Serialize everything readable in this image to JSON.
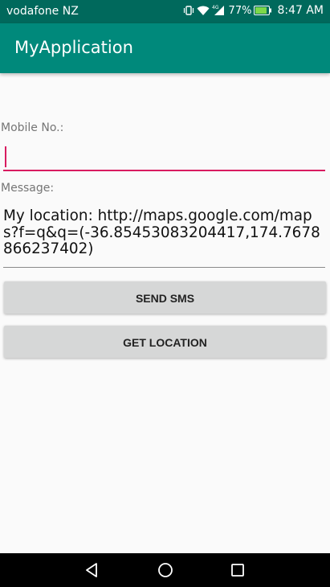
{
  "status_bar": {
    "carrier": "vodafone NZ",
    "network": "4G",
    "battery": "77%",
    "time": "8:47 AM",
    "icons": [
      "vibrate-icon",
      "wifi-icon",
      "cellular-signal-icon",
      "battery-icon"
    ]
  },
  "app_bar": {
    "title": "MyApplication"
  },
  "form": {
    "mobile_label": "Mobile No.:",
    "mobile_value": "",
    "message_label": "Message:",
    "message_value": "My location: http://maps.google.com/maps?f=q&q=(-36.85453083204417,174.7678866237402)"
  },
  "buttons": {
    "send_sms": "SEND SMS",
    "get_location": "GET LOCATION"
  },
  "nav_bar": {
    "icons": [
      "back-icon",
      "home-icon",
      "recents-icon"
    ]
  },
  "colors": {
    "status_bar": "#00695c",
    "app_bar": "#00897b",
    "accent": "#d81b60",
    "button": "#d6d7d7"
  }
}
